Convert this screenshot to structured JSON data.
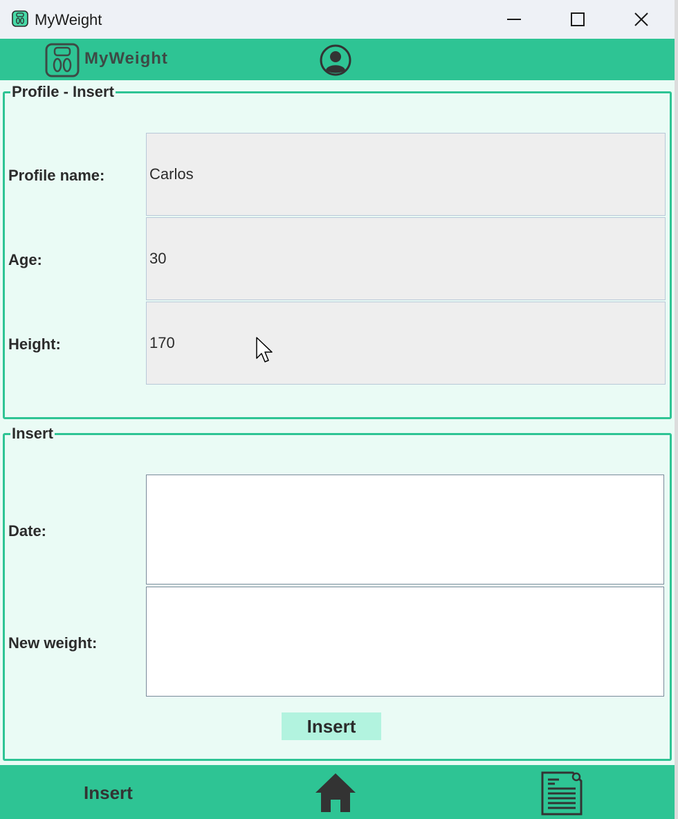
{
  "window": {
    "title": "MyWeight"
  },
  "header": {
    "app_name": "MyWeight"
  },
  "profile_section": {
    "legend": "Profile - Insert",
    "fields": [
      {
        "label": "Profile name:",
        "value": "Carlos"
      },
      {
        "label": "Age:",
        "value": "30"
      },
      {
        "label": "Height:",
        "value": "170"
      }
    ]
  },
  "insert_section": {
    "legend": "Insert",
    "date_label": "Date:",
    "date_value": "",
    "weight_label": "New weight:",
    "weight_value": "",
    "button_label": "Insert"
  },
  "footer": {
    "label": "Insert"
  },
  "icons": {
    "app": "scale-icon",
    "logo": "scale-icon",
    "profile": "user-circle-icon",
    "home": "home-icon",
    "report": "document-icon",
    "minimize": "minimize-icon",
    "maximize": "maximize-icon",
    "close": "close-icon"
  },
  "colors": {
    "accent": "#2ec494",
    "panel_bg": "#eafbf5",
    "button_bg": "#b2f3df",
    "titlebar_bg": "#eef1f6"
  }
}
